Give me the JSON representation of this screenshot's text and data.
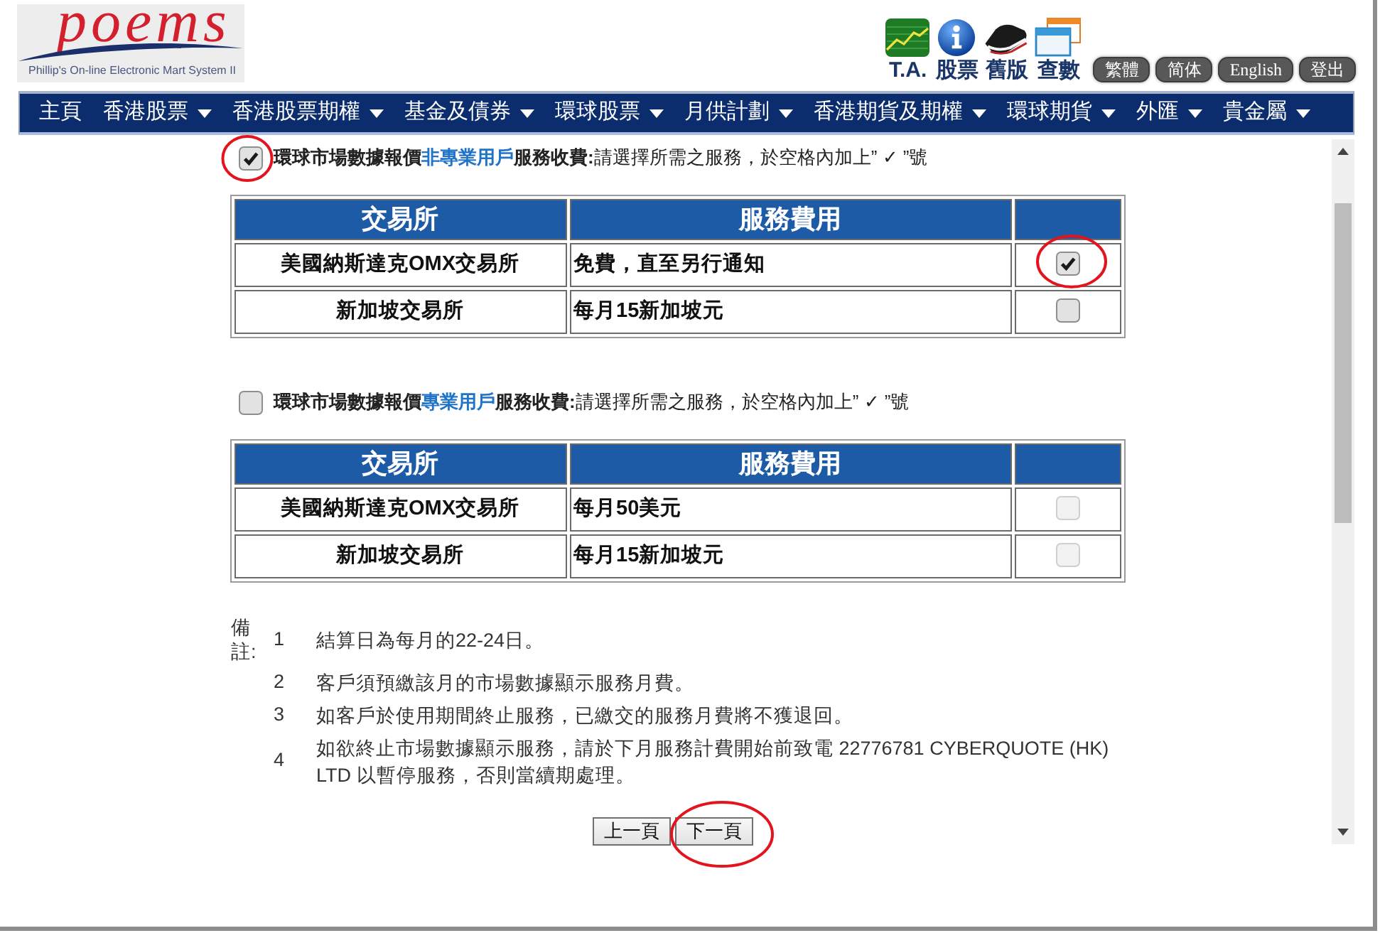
{
  "header": {
    "logo": {
      "wordmark": "poems",
      "tagline": "Phillip's On-line Electronic Mart System II"
    },
    "shortcuts": [
      {
        "kind": "chart",
        "label": "T.A."
      },
      {
        "kind": "info",
        "label": "股票"
      },
      {
        "kind": "shoe",
        "label": "舊版"
      },
      {
        "kind": "windows",
        "label": "查數"
      }
    ],
    "buttons": [
      "繁體",
      "简体",
      "English",
      "登出"
    ]
  },
  "nav": [
    {
      "label": "主頁",
      "has_menu": false
    },
    {
      "label": "香港股票",
      "has_menu": true
    },
    {
      "label": "香港股票期權",
      "has_menu": true
    },
    {
      "label": "基金及債券",
      "has_menu": true
    },
    {
      "label": "環球股票",
      "has_menu": true
    },
    {
      "label": "月供計劃",
      "has_menu": true
    },
    {
      "label": "香港期貨及期權",
      "has_menu": true
    },
    {
      "label": "環球期貨",
      "has_menu": true
    },
    {
      "label": "外匯",
      "has_menu": true
    },
    {
      "label": "貴金屬",
      "has_menu": true
    }
  ],
  "sections": [
    {
      "checked": true,
      "circled": true,
      "title": "環球市場數據報價",
      "user_type": "非專業用戶",
      "title_end": "服務收費:",
      "instruction": "請選擇所需之服務，於空格內加上” ✓ ”號",
      "table": {
        "columns": [
          "交易所",
          "服務費用"
        ],
        "rows": [
          {
            "exchange": "美國納斯達克OMX交易所",
            "fee": "免費，直至另行通知",
            "checked": true,
            "disabled": false,
            "circled": true
          },
          {
            "exchange": "新加坡交易所",
            "fee": "每月15新加坡元",
            "checked": false,
            "disabled": false,
            "circled": false
          }
        ]
      }
    },
    {
      "checked": false,
      "circled": false,
      "title": "環球市場數據報價",
      "user_type": "專業用戶",
      "title_end": "服務收費:",
      "instruction": "請選擇所需之服務，於空格內加上” ✓ ”號",
      "table": {
        "columns": [
          "交易所",
          "服務費用"
        ],
        "rows": [
          {
            "exchange": "美國納斯達克OMX交易所",
            "fee": "每月50美元",
            "checked": false,
            "disabled": true,
            "circled": false
          },
          {
            "exchange": "新加坡交易所",
            "fee": "每月15新加坡元",
            "checked": false,
            "disabled": true,
            "circled": false
          }
        ]
      }
    }
  ],
  "notes": {
    "label": "備註:",
    "items": [
      {
        "number": "1",
        "text": "結算日為每月的22-24日。"
      },
      {
        "number": "2",
        "text": "客戶須預繳該月的市場數據顯示服務月費。"
      },
      {
        "number": "3",
        "text": "如客戶於使用期間終止服務，已繳交的服務月費將不獲退回。"
      },
      {
        "number": "4",
        "text": "如欲終止市場數據顯示服務，請於下月服務計費開始前致電 22776781 CYBERQUOTE (HK) LTD 以暫停服務，否則當續期處理。"
      }
    ]
  },
  "pager": [
    {
      "label": "上一頁",
      "circled": false
    },
    {
      "label": "下一頁",
      "circled": true
    }
  ]
}
